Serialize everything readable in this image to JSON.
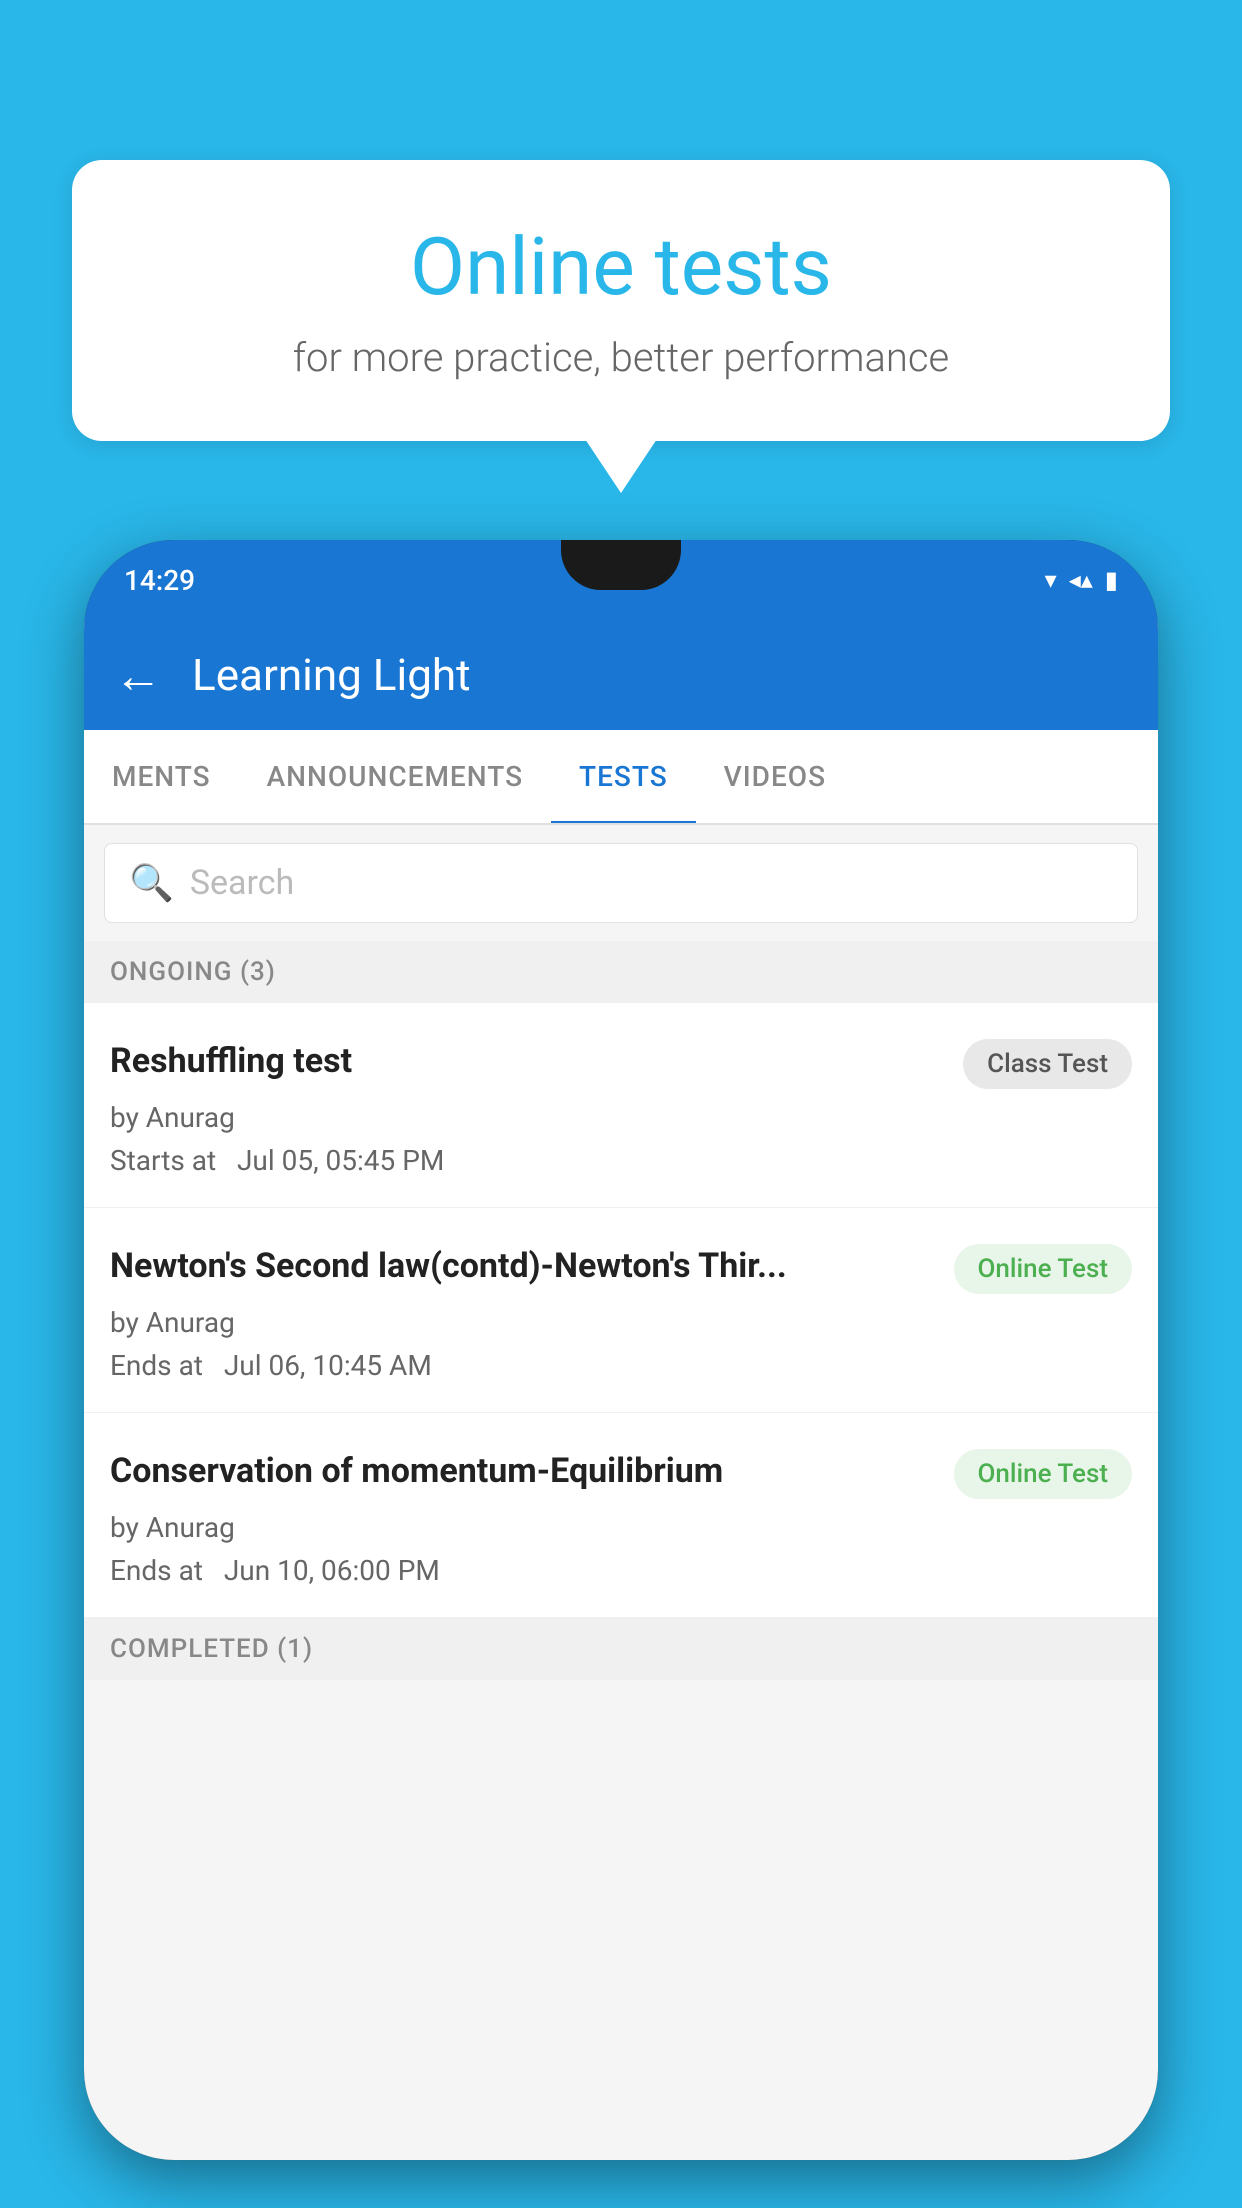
{
  "background_color": "#29b6e8",
  "speech_bubble": {
    "title": "Online tests",
    "subtitle": "for more practice, better performance"
  },
  "phone": {
    "status_bar": {
      "time": "14:29"
    },
    "header": {
      "back_label": "←",
      "title": "Learning Light"
    },
    "tabs": [
      {
        "label": "MENTS",
        "active": false
      },
      {
        "label": "ANNOUNCEMENTS",
        "active": false
      },
      {
        "label": "TESTS",
        "active": true
      },
      {
        "label": "VIDEOS",
        "active": false
      }
    ],
    "search": {
      "placeholder": "Search"
    },
    "sections": [
      {
        "header": "ONGOING (3)",
        "tests": [
          {
            "name": "Reshuffling test",
            "badge": "Class Test",
            "badge_type": "class",
            "by": "by Anurag",
            "time_label": "Starts at",
            "time": "Jul 05, 05:45 PM"
          },
          {
            "name": "Newton's Second law(contd)-Newton's Thir...",
            "badge": "Online Test",
            "badge_type": "online",
            "by": "by Anurag",
            "time_label": "Ends at",
            "time": "Jul 06, 10:45 AM"
          },
          {
            "name": "Conservation of momentum-Equilibrium",
            "badge": "Online Test",
            "badge_type": "online",
            "by": "by Anurag",
            "time_label": "Ends at",
            "time": "Jun 10, 06:00 PM"
          }
        ]
      },
      {
        "header": "COMPLETED (1)",
        "tests": []
      }
    ]
  }
}
